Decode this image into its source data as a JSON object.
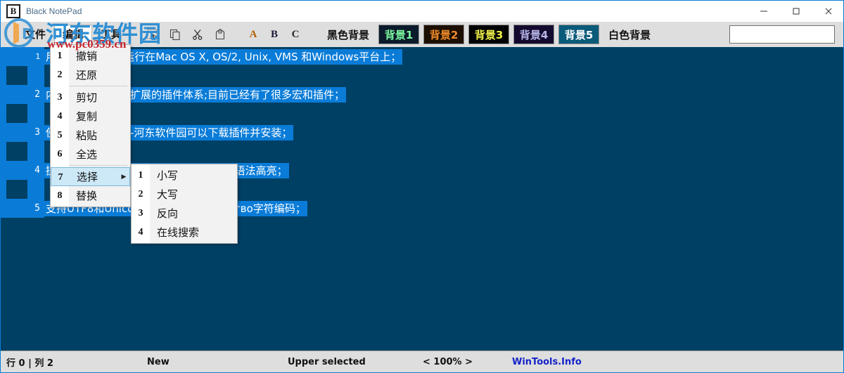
{
  "window": {
    "title": "Black NotePad",
    "icon_letter": "B",
    "icon_name": "app-icon",
    "controls": [
      {
        "name": "minimize-button",
        "glyph": "—"
      },
      {
        "name": "maximize-button",
        "glyph": "□"
      },
      {
        "name": "close-button",
        "glyph": "✕"
      }
    ]
  },
  "menubar": {
    "items": [
      {
        "label": "文件",
        "name": "menu-file",
        "active": false
      },
      {
        "label": "编辑",
        "name": "menu-edit",
        "active": true
      },
      {
        "label": "工具",
        "name": "menu-tools",
        "active": false
      }
    ]
  },
  "toolbar": {
    "icons": [
      {
        "name": "select-all-icon",
        "title": "select-all"
      },
      {
        "name": "copy-icon",
        "title": "copy"
      },
      {
        "name": "cut-icon",
        "title": "cut"
      },
      {
        "name": "paste-icon",
        "title": "paste"
      }
    ],
    "letters": [
      {
        "label": "A",
        "name": "font-a-button",
        "color": "#b26000"
      },
      {
        "label": "B",
        "name": "font-b-button",
        "color": "#1a1a3a"
      },
      {
        "label": "C",
        "name": "font-c-button",
        "color": "#2a2a2a"
      }
    ],
    "black_background_label": "黑色背景",
    "white_background_label": "白色背景",
    "background_buttons": [
      {
        "label": "背景1",
        "name": "background-1-button",
        "bg": "#0b1b2b",
        "fg": "#7df9a0",
        "border": "#8f8f8f"
      },
      {
        "label": "背景2",
        "name": "background-2-button",
        "bg": "#1c0f00",
        "fg": "#f08a2a",
        "border": "#8f8f8f"
      },
      {
        "label": "背景3",
        "name": "background-3-button",
        "bg": "#000000",
        "fg": "#f2f24a",
        "border": "#8f8f8f"
      },
      {
        "label": "背景4",
        "name": "background-4-button",
        "bg": "#130a2e",
        "fg": "#b7b7e8",
        "border": "#8f8f8f"
      },
      {
        "label": "背景5",
        "name": "background-5-button",
        "bg": "#0a5a7a",
        "fg": "#ffffff",
        "border": "#8f8f8f"
      }
    ],
    "search": {
      "value": "",
      "placeholder": ""
    }
  },
  "editor": {
    "background_color": "#004065",
    "selection_color": "#0a7cd8",
    "selection_text_color": "#ffffff",
    "lines": [
      {
        "num": "1",
        "text": "用java编写,可以运行在Mac OS X, OS/2, Unix, VMS 和Windows平台上；"
      },
      {
        "num": "2",
        "text": "内置非常强大的可扩展的插件体系;目前已经有了很多宏和插件；"
      },
      {
        "num": "3",
        "text": "使用者在插件中心-河东软件园可以下载插件并安装；"
      },
      {
        "num": "4",
        "text": "提供对多达130种编程语言的自动缩进和语法高亮；"
      },
      {
        "num": "5",
        "text": "支持UTF8和Unicode在内的上количество字符编码；"
      }
    ]
  },
  "edit_menu": {
    "name": "edit-dropdown",
    "items": [
      {
        "num": "1",
        "label": "撤销",
        "name": "menu-undo",
        "has_submenu": false,
        "highlighted": false
      },
      {
        "num": "2",
        "label": "还原",
        "name": "menu-redo",
        "has_submenu": false,
        "highlighted": false
      },
      {
        "separator": true
      },
      {
        "num": "3",
        "label": "剪切",
        "name": "menu-cut",
        "has_submenu": false,
        "highlighted": false
      },
      {
        "num": "4",
        "label": "复制",
        "name": "menu-copy",
        "has_submenu": false,
        "highlighted": false
      },
      {
        "num": "5",
        "label": "粘贴",
        "name": "menu-paste",
        "has_submenu": false,
        "highlighted": false
      },
      {
        "num": "6",
        "label": "全选",
        "name": "menu-select-all",
        "has_submenu": false,
        "highlighted": false
      },
      {
        "separator": true
      },
      {
        "num": "7",
        "label": "选择",
        "name": "menu-select",
        "has_submenu": true,
        "highlighted": true,
        "arrow": "▶"
      },
      {
        "num": "8",
        "label": "替换",
        "name": "menu-replace",
        "has_submenu": false,
        "highlighted": false
      }
    ]
  },
  "select_submenu": {
    "name": "select-submenu",
    "items": [
      {
        "num": "1",
        "label": "小写",
        "name": "submenu-lowercase"
      },
      {
        "num": "2",
        "label": "大写",
        "name": "submenu-uppercase"
      },
      {
        "num": "3",
        "label": "反向",
        "name": "submenu-reverse"
      },
      {
        "num": "4",
        "label": "在线搜索",
        "name": "submenu-online-search"
      }
    ]
  },
  "statusbar": {
    "position": "行 0 | 列 2",
    "file_state": "New",
    "selection_state": "Upper selected",
    "zoom": "< 100% >",
    "brand": "WinTools.Info"
  },
  "watermark": {
    "site_name": "河东软件园",
    "url": "www.pc0359.cn"
  }
}
